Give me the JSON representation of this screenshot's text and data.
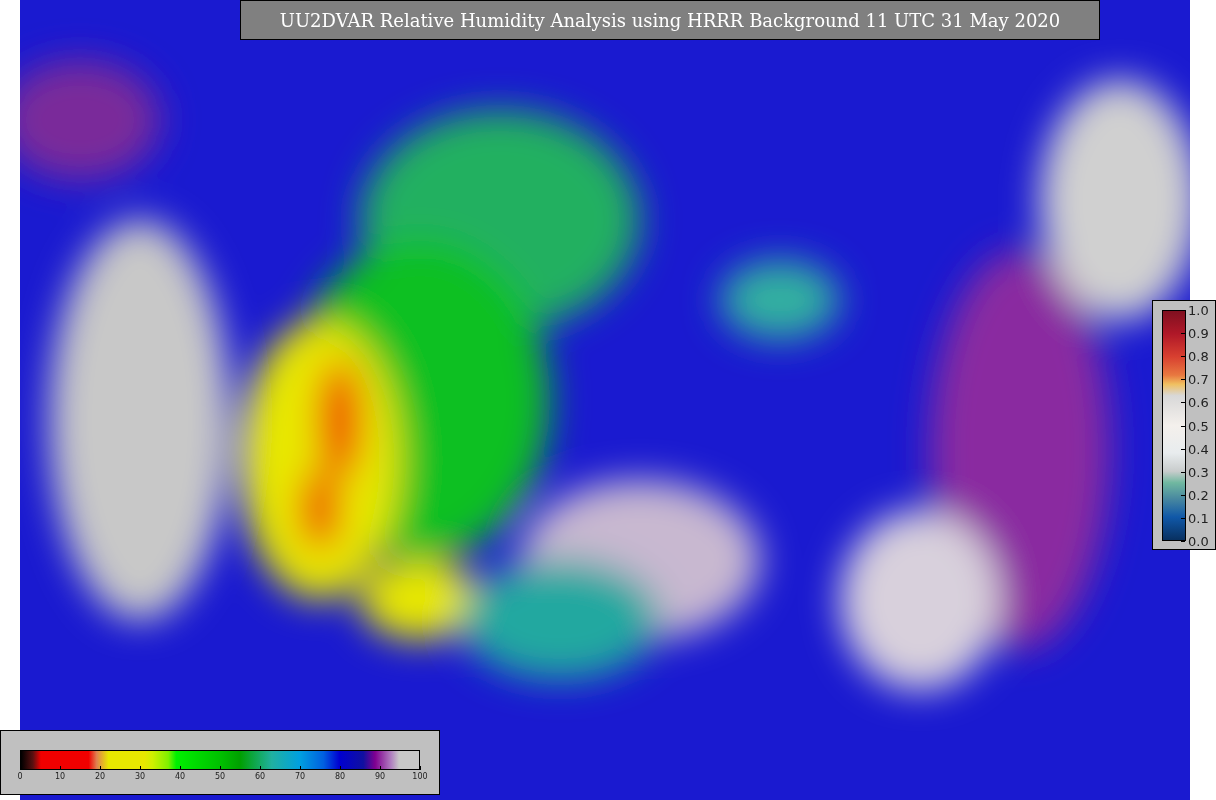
{
  "title": "UU2DVAR Relative Humidity Analysis using HRRR Background 11 UTC 31 May 2020",
  "humidity_colorbar": {
    "ticks": [
      "0",
      "10",
      "20",
      "30",
      "40",
      "50",
      "60",
      "70",
      "80",
      "90",
      "100"
    ]
  },
  "station_colorbar": {
    "ticks": [
      "1.0",
      "0.9",
      "0.8",
      "0.7",
      "0.6",
      "0.5",
      "0.4",
      "0.3",
      "0.2",
      "0.1",
      "0.0"
    ]
  }
}
